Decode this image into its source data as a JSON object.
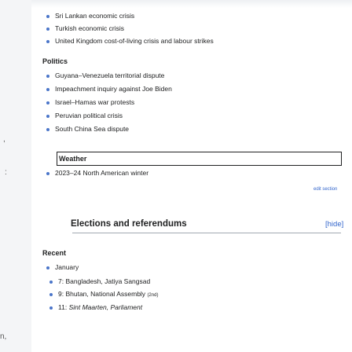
{
  "top_items": [
    "Sri Lankan economic crisis",
    "Turkish economic crisis",
    "United Kingdom cost-of-living crisis and labour strikes"
  ],
  "politics": {
    "heading": "Politics",
    "items": [
      "Guyana–Venezuela territorial dispute",
      "Impeachment inquiry against Joe Biden",
      "Israel–Hamas war protests",
      "Peruvian political crisis",
      "South China Sea dispute"
    ]
  },
  "weather": {
    "heading": "Weather",
    "items": [
      "2023–24 North American winter"
    ]
  },
  "edit_section": "edit section",
  "elections": {
    "heading": "Elections and referendums",
    "hide_label": "[hide]",
    "recent_heading": "Recent",
    "month": "January",
    "entries": [
      {
        "date": "7:",
        "text": "Bangladesh, Jatiya Sangsad",
        "note": ""
      },
      {
        "date": "9:",
        "text": "Bhutan, National Assembly",
        "note": "(2nd)"
      },
      {
        "date": "11:",
        "text": "Sint Maarten, Parliament",
        "note": ""
      }
    ]
  },
  "left_margin_marks": [
    ",",
    ":",
    "n,"
  ]
}
